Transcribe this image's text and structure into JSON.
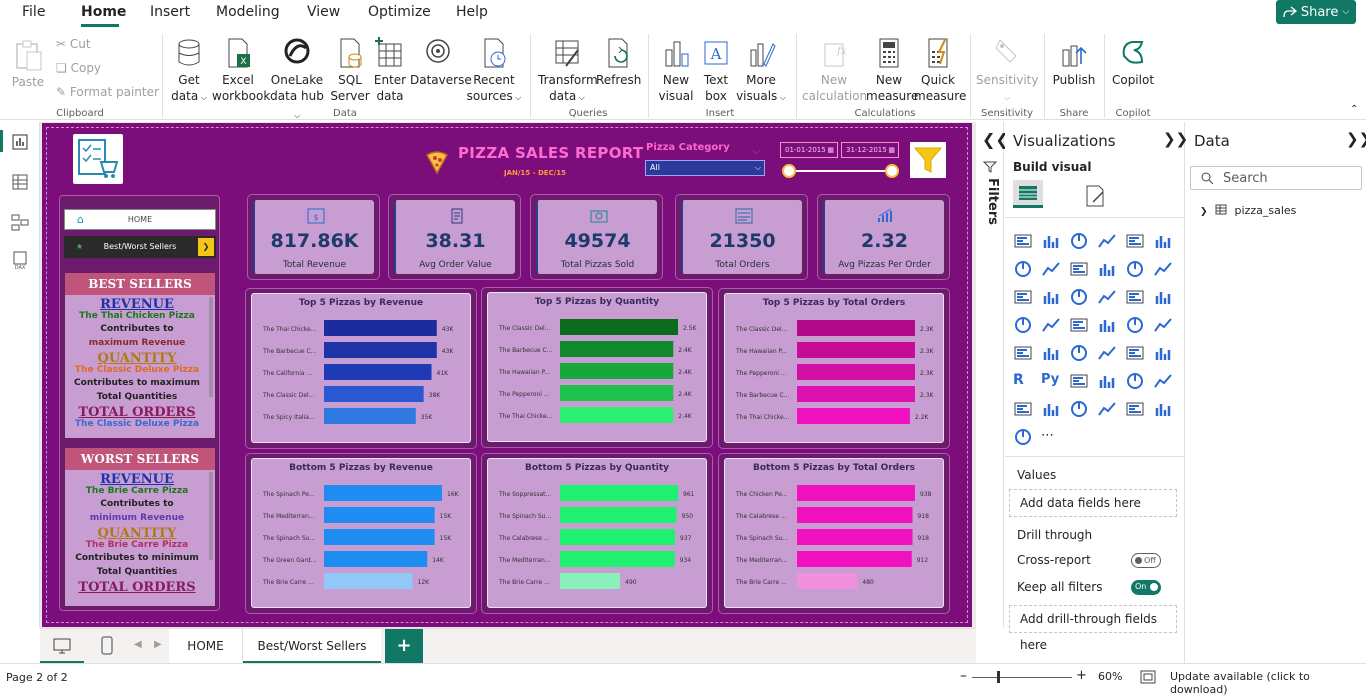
{
  "menu": {
    "items": [
      "File",
      "Home",
      "Insert",
      "Modeling",
      "View",
      "Optimize",
      "Help"
    ],
    "share": "Share"
  },
  "ribbon": {
    "clipboard": {
      "paste": "Paste",
      "cut": "Cut",
      "copy": "Copy",
      "format_painter": "Format painter",
      "group": "Clipboard"
    },
    "data": {
      "get_data": [
        "Get",
        "data"
      ],
      "excel": [
        "Excel",
        "workbook"
      ],
      "onelake": [
        "OneLake",
        "data hub"
      ],
      "sql": [
        "SQL",
        "Server"
      ],
      "enter": [
        "Enter",
        "data"
      ],
      "dataverse": [
        "Dataverse",
        ""
      ],
      "recent": [
        "Recent",
        "sources"
      ],
      "group": "Data"
    },
    "queries": {
      "transform": [
        "Transform",
        "data"
      ],
      "refresh": [
        "Refresh",
        ""
      ],
      "group": "Queries"
    },
    "insert": {
      "new_visual": [
        "New",
        "visual"
      ],
      "text_box": [
        "Text",
        "box"
      ],
      "more_visuals": [
        "More",
        "visuals"
      ],
      "group": "Insert"
    },
    "calculations": {
      "new_calc": [
        "New",
        "calculation"
      ],
      "new_measure": [
        "New",
        "measure"
      ],
      "quick_measure": [
        "Quick",
        "measure"
      ],
      "group": "Calculations"
    },
    "sensitivity": {
      "label": "Sensitivity",
      "group": "Sensitivity"
    },
    "share": {
      "publish": "Publish",
      "group": "Share"
    },
    "copilot": {
      "label": "Copilot",
      "group": "Copilot"
    }
  },
  "report": {
    "title": "PIZZA SALES REPORT",
    "subtitle": "JAN/15  -  DEC/15",
    "category_label": "Pizza Category",
    "category_value": "All",
    "date_from": "01-01-2015",
    "date_to": "31-12-2015",
    "nav": {
      "home": "HOME",
      "best_worst": "Best/Worst Sellers"
    },
    "best": {
      "header": "BEST SELLERS",
      "lines": [
        {
          "t": "REVENUE",
          "c": "#1a33aa",
          "big": true
        },
        {
          "t": "The Thai Chicken Pizza",
          "c": "#1a7a1a",
          "big": false
        },
        {
          "t": "Contributes to",
          "c": "#222",
          "big": false
        },
        {
          "t": "maximum Revenue",
          "c": "#8a2a2a",
          "big": false
        },
        {
          "t": "QUANTITY",
          "c": "#b07a12",
          "big": true
        },
        {
          "t": "The Classic Deluxe Pizza",
          "c": "#e06a20",
          "big": false
        },
        {
          "t": "Contributes to maximum",
          "c": "#222",
          "big": false
        },
        {
          "t": "Total Quantities",
          "c": "#222",
          "big": false
        },
        {
          "t": "TOTAL ORDERS",
          "c": "#8a1a5a",
          "big": true
        },
        {
          "t": "The Classic Deluxe Pizza",
          "c": "#3a6ad0",
          "big": false
        }
      ]
    },
    "worst": {
      "header": "WORST SELLERS",
      "lines": [
        {
          "t": "REVENUE",
          "c": "#1a33aa",
          "big": true
        },
        {
          "t": "The Brie Carre Pizza",
          "c": "#1a7a1a",
          "big": false
        },
        {
          "t": "Contributes to",
          "c": "#222",
          "big": false
        },
        {
          "t": "minimum Revenue",
          "c": "#5a3ab0",
          "big": false
        },
        {
          "t": "QUANTITY",
          "c": "#b07a12",
          "big": true
        },
        {
          "t": "The Brie Carre Pizza",
          "c": "#b0306a",
          "big": false
        },
        {
          "t": "Contributes to minimum",
          "c": "#222",
          "big": false
        },
        {
          "t": "Total Quantities",
          "c": "#222",
          "big": false
        },
        {
          "t": "TOTAL ORDERS",
          "c": "#8a1a5a",
          "big": true
        }
      ]
    },
    "kpis": [
      {
        "value": "817.86K",
        "label": "Total Revenue"
      },
      {
        "value": "38.31",
        "label": "Avg Order Value"
      },
      {
        "value": "49574",
        "label": "Total Pizzas Sold"
      },
      {
        "value": "21350",
        "label": "Total Orders"
      },
      {
        "value": "2.32",
        "label": "Avg Pizzas Per Order"
      }
    ]
  },
  "chart_data": [
    {
      "type": "bar",
      "title": "Top 5 Pizzas by Revenue",
      "categories": [
        "The Thai Chicke...",
        "The Barbecue C...",
        "The California ...",
        "The Classic Del...",
        "The Spicy Italia..."
      ],
      "values": [
        43,
        43,
        41,
        38,
        35
      ],
      "labels": [
        "43K",
        "43K",
        "41K",
        "38K",
        "35K"
      ],
      "colors": [
        "#1c2c9c",
        "#1d33a8",
        "#1f3ab5",
        "#2a58d2",
        "#2f7ae0"
      ],
      "xlim": [
        0,
        45
      ]
    },
    {
      "type": "bar",
      "title": "Top 5 Pizzas by Quantity",
      "categories": [
        "The Classic Del...",
        "The Barbecue C...",
        "The Hawaiian P...",
        "The Pepperoni ...",
        "The Thai Chicke..."
      ],
      "values": [
        2.5,
        2.4,
        2.4,
        2.4,
        2.4
      ],
      "labels": [
        "2.5K",
        "2.4K",
        "2.4K",
        "2.4K",
        "2.4K"
      ],
      "colors": [
        "#0c6a1c",
        "#0f8a2a",
        "#16a83a",
        "#1fc04c",
        "#2ef070"
      ],
      "xlim": [
        0,
        2.5
      ]
    },
    {
      "type": "bar",
      "title": "Top 5 Pizzas by Total Orders",
      "categories": [
        "The Classic Del...",
        "The Hawaiian P...",
        "The Pepperoni ...",
        "The Barbecue C...",
        "The Thai Chicke..."
      ],
      "values": [
        2.3,
        2.3,
        2.3,
        2.3,
        2.2
      ],
      "labels": [
        "2.3K",
        "2.3K",
        "2.3K",
        "2.3K",
        "2.2K"
      ],
      "colors": [
        "#b00a8a",
        "#c40c96",
        "#d20ea4",
        "#de10b0",
        "#f010c0"
      ],
      "xlim": [
        0,
        2.3
      ]
    },
    {
      "type": "bar",
      "title": "Bottom 5 Pizzas by Revenue",
      "categories": [
        "The Spinach Pe...",
        "The Mediterran...",
        "The Spinach Su...",
        "The Green Gard...",
        "The Brie Carre ..."
      ],
      "values": [
        16,
        15,
        15,
        14,
        12
      ],
      "labels": [
        "16K",
        "15K",
        "15K",
        "14K",
        "12K"
      ],
      "colors": [
        "#1e8cf0",
        "#1e8cf0",
        "#1e8cf0",
        "#1e8cf0",
        "#90c8f8"
      ],
      "xlim": [
        0,
        16
      ]
    },
    {
      "type": "bar",
      "title": "Bottom 5 Pizzas by Quantity",
      "categories": [
        "The Soppressat...",
        "The Spinach Su...",
        "The Calabrese ...",
        "The Mediterran...",
        "The Brie Carre ..."
      ],
      "values": [
        961,
        950,
        937,
        934,
        490
      ],
      "labels": [
        "961",
        "950",
        "937",
        "934",
        "490"
      ],
      "colors": [
        "#1ff070",
        "#1ff070",
        "#1ff070",
        "#1ff070",
        "#88f0b8"
      ],
      "xlim": [
        0,
        961
      ]
    },
    {
      "type": "bar",
      "title": "Bottom 5 Pizzas by Total Orders",
      "categories": [
        "The Chicken Pe...",
        "The Calabrese ...",
        "The Spinach Su...",
        "The Mediterran...",
        "The Brie Carre ..."
      ],
      "values": [
        938,
        918,
        918,
        912,
        480
      ],
      "labels": [
        "938",
        "918",
        "918",
        "912",
        "480"
      ],
      "colors": [
        "#f010c0",
        "#f010c0",
        "#f010c0",
        "#f010c0",
        "#f090dc"
      ],
      "xlim": [
        0,
        938
      ]
    }
  ],
  "pages": {
    "home": "HOME",
    "best_worst": "Best/Worst Sellers",
    "add": "+"
  },
  "status": {
    "page": "Page 2 of 2",
    "zoom": "60%",
    "update": "Update available (click to download)"
  },
  "filters": {
    "label": "Filters"
  },
  "viz": {
    "title": "Visualizations",
    "build": "Build visual",
    "values": "Values",
    "add_data": "Add data fields here",
    "drill": "Drill through",
    "cross": "Cross-report",
    "cross_state": "Off",
    "keep": "Keep all filters",
    "keep_state": "On",
    "add_drill": "Add drill-through fields here"
  },
  "data_pane": {
    "title": "Data",
    "search_placeholder": "Search",
    "table": "pizza_sales"
  },
  "colors": {
    "accent": "#117865",
    "report_bg": "#7b0e7b",
    "card_bg": "#c79dd2"
  }
}
